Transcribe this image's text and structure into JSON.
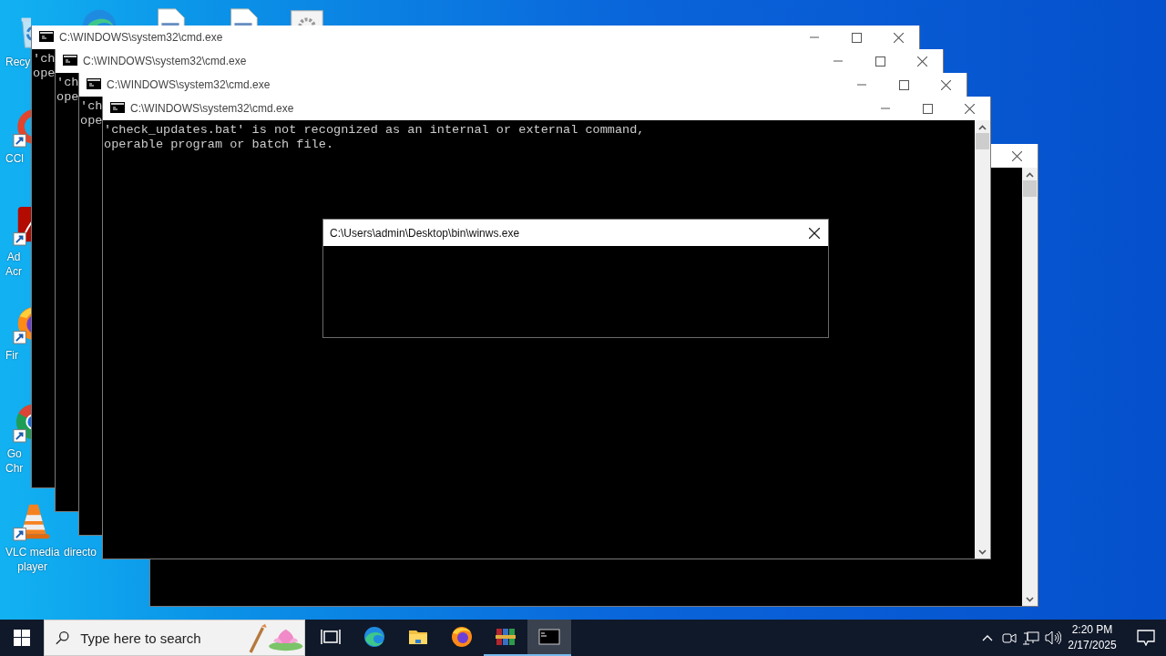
{
  "desktop": {
    "top_icons": [
      {
        "kind": "edge"
      },
      {
        "kind": "document"
      },
      {
        "kind": "document"
      },
      {
        "kind": "settings-doc"
      }
    ],
    "icons": [
      {
        "kind": "recycle-bin",
        "shortcut": false,
        "lines": [
          "Recy"
        ]
      },
      {
        "kind": "cleaner",
        "shortcut": true,
        "lines": [
          "CCl"
        ]
      },
      {
        "kind": "pdf",
        "shortcut": true,
        "lines": [
          "Ad",
          "Acr"
        ]
      },
      {
        "kind": "firefox",
        "shortcut": true,
        "lines": [
          "Fir"
        ]
      },
      {
        "kind": "chrome",
        "shortcut": true,
        "lines": [
          "Go",
          "Chr"
        ]
      },
      {
        "kind": "vlc",
        "shortcut": true,
        "lines": [
          "VLC media",
          "player"
        ]
      },
      {
        "lines": [
          "directo"
        ]
      }
    ]
  },
  "windows": [
    {
      "title": "C:\\WINDOWS\\system32\\cmd.exe",
      "lines": [
        "'ch",
        "ope"
      ]
    },
    {
      "title": "C:\\WINDOWS\\system32\\cmd.exe",
      "lines": [
        "'ch",
        "ope"
      ]
    },
    {
      "title": "C:\\WINDOWS\\system32\\cmd.exe",
      "lines": [
        "'ch",
        "ope"
      ]
    },
    {
      "title": "C:\\WINDOWS\\system32\\cmd.exe",
      "lines": [
        "'check_updates.bat' is not recognized as an internal or external command,",
        "operable program or batch file."
      ]
    }
  ],
  "dialog": {
    "title": "C:\\Users\\admin\\Desktop\\bin\\winws.exe"
  },
  "taskbar": {
    "search": {
      "placeholder": "Type here to search"
    },
    "apps": [
      {
        "kind": "task-view",
        "running": false,
        "selected": false
      },
      {
        "kind": "edge",
        "running": false,
        "selected": false
      },
      {
        "kind": "explorer",
        "running": false,
        "selected": false
      },
      {
        "kind": "firefox",
        "running": false,
        "selected": false
      },
      {
        "kind": "winrar",
        "running": true,
        "selected": false
      },
      {
        "kind": "terminal",
        "running": true,
        "selected": true
      }
    ],
    "clock": {
      "time": "2:20 PM",
      "date": "2/17/2025"
    }
  }
}
